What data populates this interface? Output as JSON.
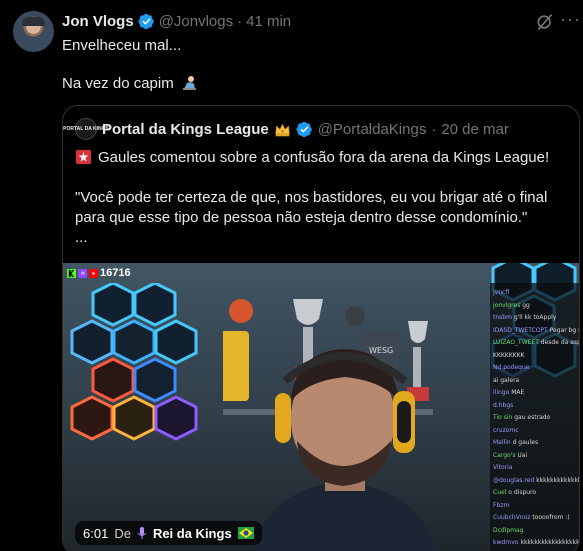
{
  "tweet": {
    "author_name": "Jon Vlogs",
    "handle": "@Jonvlogs",
    "separator": "·",
    "time": "41 min",
    "line1": "Envelheceu mal...",
    "line2": "Na vez do capim",
    "more_label": "···"
  },
  "quote": {
    "avatar_label": "PORTAL DA KINGS",
    "author_name": "Portal da Kings League",
    "handle": "@PortaldaKings",
    "separator": "·",
    "date": "20 de mar",
    "line1": "Gaules comentou sobre a confusão fora da arena da Kings League!",
    "line2": "\"Você pode ter certeza de que, nos bastidores, eu vou brigar até o final",
    "line3": "para que esse tipo de pessoa não esteja dentro desse condomínio.\"",
    "line4": "..."
  },
  "media": {
    "viewer_count": "16716",
    "duration": "6:01",
    "from_label": "De",
    "channel": "Rei da Kings",
    "chat_lines": [
      {
        "user": "jvncfl",
        "msg": ""
      },
      {
        "user": "jonvlgres",
        "msg": "gg"
      },
      {
        "user": "tnsbm",
        "msg": "g'll  kk toApply"
      },
      {
        "user": "IDASD_TWETCOPT",
        "msg": "Pegar  bg  sbhosas a pinto"
      },
      {
        "user": "LUIZAO_TWEET",
        "msg": "desde da  aspiração"
      },
      {
        "user": "",
        "msg": "KKKKKKKK"
      },
      {
        "user": "Nd.podeque",
        "msg": ""
      },
      {
        "user": "",
        "msg": "ai galera"
      },
      {
        "user": "ilingo",
        "msg": "MAE"
      },
      {
        "user": "d.hbgs",
        "msg": ""
      },
      {
        "user": "Tio sin",
        "msg": "gau  estrado"
      },
      {
        "user": "cruzomc",
        "msg": ""
      },
      {
        "user": "Mallin",
        "msg": "d gaules"
      },
      {
        "user": "Cargo's",
        "msg": "Uai"
      },
      {
        "user": "Vitoria",
        "msg": ""
      },
      {
        "user": "@douglas.red",
        "msg": "kkkkkkkkkkkkkkkk"
      },
      {
        "user": "Cuel",
        "msg": "o dispuro"
      },
      {
        "user": "Fbzm",
        "msg": ""
      },
      {
        "user": "CuubchVnoz",
        "msg": "toooofrom  :)"
      },
      {
        "user": "Dcdlpmag",
        "msg": ""
      },
      {
        "user": "kwdrnvo",
        "msg": "kkkkkkkkkkkkkkkkkkkkkkkk"
      }
    ]
  },
  "colors": {
    "background": "#000000",
    "text": "#e7e9ea",
    "muted": "#71767b",
    "border": "#2f3336",
    "verified": "#1d9bf0"
  }
}
